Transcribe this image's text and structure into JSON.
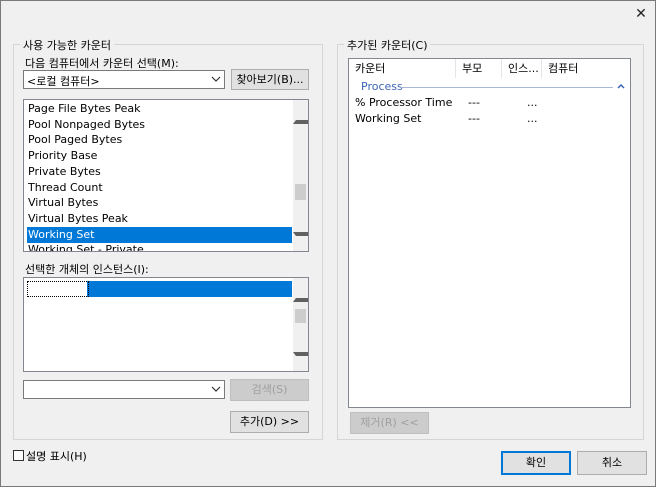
{
  "window": {
    "close_glyph": "✕"
  },
  "available_counters": {
    "group_title": "사용 가능한 카운터",
    "select_computer_label": "다음 컴퓨터에서 카운터 선택(M):",
    "computer_value": "<로컬 컴퓨터>",
    "browse_button": "찾아보기(B)...",
    "counters": [
      {
        "label": "Page File Bytes Peak",
        "selected": false
      },
      {
        "label": "Pool Nonpaged Bytes",
        "selected": false
      },
      {
        "label": "Pool Paged Bytes",
        "selected": false
      },
      {
        "label": "Priority Base",
        "selected": false
      },
      {
        "label": "Private Bytes",
        "selected": false
      },
      {
        "label": "Thread Count",
        "selected": false
      },
      {
        "label": "Virtual Bytes",
        "selected": false
      },
      {
        "label": "Virtual Bytes Peak",
        "selected": false
      },
      {
        "label": "Working Set",
        "selected": true
      },
      {
        "label": "Working Set - Private",
        "selected": false
      }
    ],
    "instances_label": "선택한 개체의 인스턴스(I):",
    "search_value": "",
    "search_button": "검색(S)",
    "add_button": "추가(D) >>"
  },
  "added_counters": {
    "group_title": "추가된 카운터(C)",
    "columns": [
      "카운터",
      "부모",
      "인스...",
      "컴퓨터"
    ],
    "group_row": "Process",
    "rows": [
      {
        "counter": "% Processor Time",
        "parent": "---",
        "instance": "..."
      },
      {
        "counter": "Working Set",
        "parent": "---",
        "instance": "..."
      }
    ],
    "remove_button": "제거(R) <<"
  },
  "footer": {
    "show_description": "설명 표시(H)",
    "show_description_checked": false,
    "ok_button": "확인",
    "cancel_button": "취소"
  },
  "colors": {
    "selection": "#0078d7",
    "group_text": "#3c64b4"
  }
}
